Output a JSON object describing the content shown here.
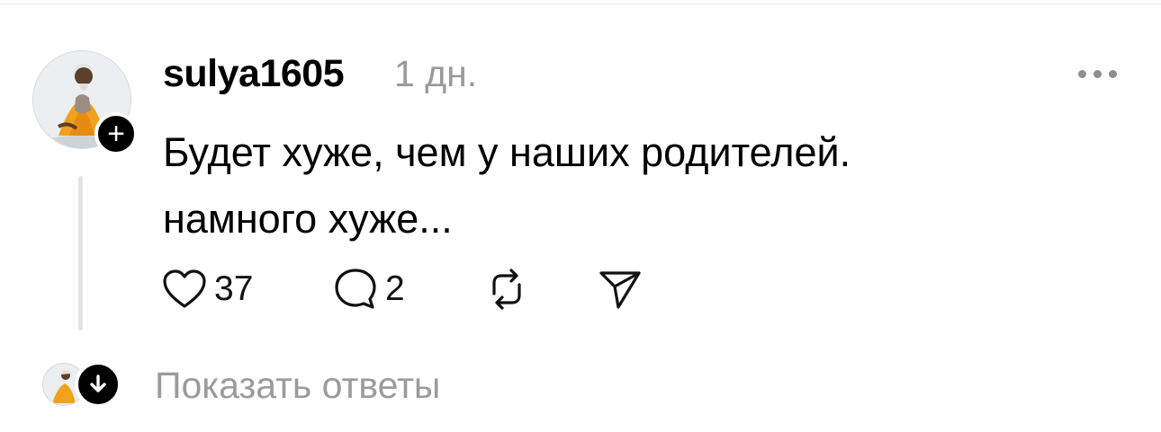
{
  "comment": {
    "author": "sulya1605",
    "time": "1 дн.",
    "text_lines": [
      "Будет хуже, чем у наших родителей.",
      "намного хуже..."
    ],
    "follow_badge": "+",
    "more_icon": "ellipsis-icon"
  },
  "actions": {
    "like_count": "37",
    "reply_count": "2",
    "icons": [
      "heart-icon",
      "comment-icon",
      "repost-icon",
      "share-icon"
    ]
  },
  "replies": {
    "label": "Показать ответы"
  }
}
